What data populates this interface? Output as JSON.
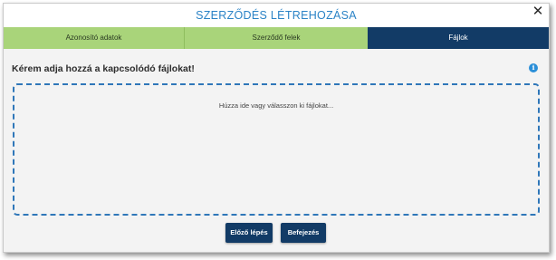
{
  "dialog": {
    "title": "SZERZŐDÉS LÉTREHOZÁSA",
    "close_glyph": "✕"
  },
  "steps": [
    {
      "label": "Azonosító adatok",
      "state": "done"
    },
    {
      "label": "Szerződő felek",
      "state": "done"
    },
    {
      "label": "Fájlok",
      "state": "active"
    }
  ],
  "content": {
    "heading": "Kérem adja hozzá a kapcsolódó fájlokat!",
    "info_glyph": "i",
    "dropzone_text": "Húzza ide vagy válasszon ki fájlokat..."
  },
  "buttons": {
    "prev_label": "Előző lépés",
    "finish_label": "Befejezés"
  },
  "colors": {
    "title": "#2b83c6",
    "step_done": "#a9d47a",
    "step_active": "#123b66",
    "dropzone_border": "#2f77b9",
    "button": "#123b66"
  }
}
